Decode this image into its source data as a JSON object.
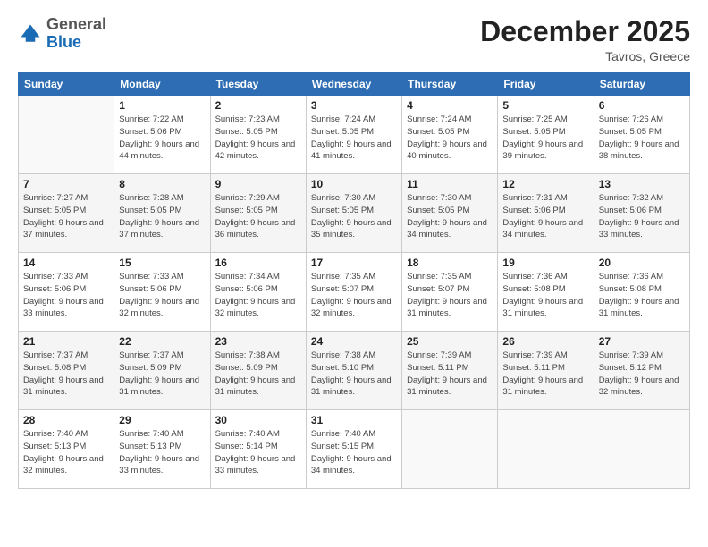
{
  "header": {
    "logo_general": "General",
    "logo_blue": "Blue",
    "month_title": "December 2025",
    "location": "Tavros, Greece"
  },
  "weekdays": [
    "Sunday",
    "Monday",
    "Tuesday",
    "Wednesday",
    "Thursday",
    "Friday",
    "Saturday"
  ],
  "weeks": [
    [
      {
        "day": "",
        "sunrise": "",
        "sunset": "",
        "daylight": ""
      },
      {
        "day": "1",
        "sunrise": "Sunrise: 7:22 AM",
        "sunset": "Sunset: 5:06 PM",
        "daylight": "Daylight: 9 hours and 44 minutes."
      },
      {
        "day": "2",
        "sunrise": "Sunrise: 7:23 AM",
        "sunset": "Sunset: 5:05 PM",
        "daylight": "Daylight: 9 hours and 42 minutes."
      },
      {
        "day": "3",
        "sunrise": "Sunrise: 7:24 AM",
        "sunset": "Sunset: 5:05 PM",
        "daylight": "Daylight: 9 hours and 41 minutes."
      },
      {
        "day": "4",
        "sunrise": "Sunrise: 7:24 AM",
        "sunset": "Sunset: 5:05 PM",
        "daylight": "Daylight: 9 hours and 40 minutes."
      },
      {
        "day": "5",
        "sunrise": "Sunrise: 7:25 AM",
        "sunset": "Sunset: 5:05 PM",
        "daylight": "Daylight: 9 hours and 39 minutes."
      },
      {
        "day": "6",
        "sunrise": "Sunrise: 7:26 AM",
        "sunset": "Sunset: 5:05 PM",
        "daylight": "Daylight: 9 hours and 38 minutes."
      }
    ],
    [
      {
        "day": "7",
        "sunrise": "Sunrise: 7:27 AM",
        "sunset": "Sunset: 5:05 PM",
        "daylight": "Daylight: 9 hours and 37 minutes."
      },
      {
        "day": "8",
        "sunrise": "Sunrise: 7:28 AM",
        "sunset": "Sunset: 5:05 PM",
        "daylight": "Daylight: 9 hours and 37 minutes."
      },
      {
        "day": "9",
        "sunrise": "Sunrise: 7:29 AM",
        "sunset": "Sunset: 5:05 PM",
        "daylight": "Daylight: 9 hours and 36 minutes."
      },
      {
        "day": "10",
        "sunrise": "Sunrise: 7:30 AM",
        "sunset": "Sunset: 5:05 PM",
        "daylight": "Daylight: 9 hours and 35 minutes."
      },
      {
        "day": "11",
        "sunrise": "Sunrise: 7:30 AM",
        "sunset": "Sunset: 5:05 PM",
        "daylight": "Daylight: 9 hours and 34 minutes."
      },
      {
        "day": "12",
        "sunrise": "Sunrise: 7:31 AM",
        "sunset": "Sunset: 5:06 PM",
        "daylight": "Daylight: 9 hours and 34 minutes."
      },
      {
        "day": "13",
        "sunrise": "Sunrise: 7:32 AM",
        "sunset": "Sunset: 5:06 PM",
        "daylight": "Daylight: 9 hours and 33 minutes."
      }
    ],
    [
      {
        "day": "14",
        "sunrise": "Sunrise: 7:33 AM",
        "sunset": "Sunset: 5:06 PM",
        "daylight": "Daylight: 9 hours and 33 minutes."
      },
      {
        "day": "15",
        "sunrise": "Sunrise: 7:33 AM",
        "sunset": "Sunset: 5:06 PM",
        "daylight": "Daylight: 9 hours and 32 minutes."
      },
      {
        "day": "16",
        "sunrise": "Sunrise: 7:34 AM",
        "sunset": "Sunset: 5:06 PM",
        "daylight": "Daylight: 9 hours and 32 minutes."
      },
      {
        "day": "17",
        "sunrise": "Sunrise: 7:35 AM",
        "sunset": "Sunset: 5:07 PM",
        "daylight": "Daylight: 9 hours and 32 minutes."
      },
      {
        "day": "18",
        "sunrise": "Sunrise: 7:35 AM",
        "sunset": "Sunset: 5:07 PM",
        "daylight": "Daylight: 9 hours and 31 minutes."
      },
      {
        "day": "19",
        "sunrise": "Sunrise: 7:36 AM",
        "sunset": "Sunset: 5:08 PM",
        "daylight": "Daylight: 9 hours and 31 minutes."
      },
      {
        "day": "20",
        "sunrise": "Sunrise: 7:36 AM",
        "sunset": "Sunset: 5:08 PM",
        "daylight": "Daylight: 9 hours and 31 minutes."
      }
    ],
    [
      {
        "day": "21",
        "sunrise": "Sunrise: 7:37 AM",
        "sunset": "Sunset: 5:08 PM",
        "daylight": "Daylight: 9 hours and 31 minutes."
      },
      {
        "day": "22",
        "sunrise": "Sunrise: 7:37 AM",
        "sunset": "Sunset: 5:09 PM",
        "daylight": "Daylight: 9 hours and 31 minutes."
      },
      {
        "day": "23",
        "sunrise": "Sunrise: 7:38 AM",
        "sunset": "Sunset: 5:09 PM",
        "daylight": "Daylight: 9 hours and 31 minutes."
      },
      {
        "day": "24",
        "sunrise": "Sunrise: 7:38 AM",
        "sunset": "Sunset: 5:10 PM",
        "daylight": "Daylight: 9 hours and 31 minutes."
      },
      {
        "day": "25",
        "sunrise": "Sunrise: 7:39 AM",
        "sunset": "Sunset: 5:11 PM",
        "daylight": "Daylight: 9 hours and 31 minutes."
      },
      {
        "day": "26",
        "sunrise": "Sunrise: 7:39 AM",
        "sunset": "Sunset: 5:11 PM",
        "daylight": "Daylight: 9 hours and 31 minutes."
      },
      {
        "day": "27",
        "sunrise": "Sunrise: 7:39 AM",
        "sunset": "Sunset: 5:12 PM",
        "daylight": "Daylight: 9 hours and 32 minutes."
      }
    ],
    [
      {
        "day": "28",
        "sunrise": "Sunrise: 7:40 AM",
        "sunset": "Sunset: 5:13 PM",
        "daylight": "Daylight: 9 hours and 32 minutes."
      },
      {
        "day": "29",
        "sunrise": "Sunrise: 7:40 AM",
        "sunset": "Sunset: 5:13 PM",
        "daylight": "Daylight: 9 hours and 33 minutes."
      },
      {
        "day": "30",
        "sunrise": "Sunrise: 7:40 AM",
        "sunset": "Sunset: 5:14 PM",
        "daylight": "Daylight: 9 hours and 33 minutes."
      },
      {
        "day": "31",
        "sunrise": "Sunrise: 7:40 AM",
        "sunset": "Sunset: 5:15 PM",
        "daylight": "Daylight: 9 hours and 34 minutes."
      },
      {
        "day": "",
        "sunrise": "",
        "sunset": "",
        "daylight": ""
      },
      {
        "day": "",
        "sunrise": "",
        "sunset": "",
        "daylight": ""
      },
      {
        "day": "",
        "sunrise": "",
        "sunset": "",
        "daylight": ""
      }
    ]
  ]
}
